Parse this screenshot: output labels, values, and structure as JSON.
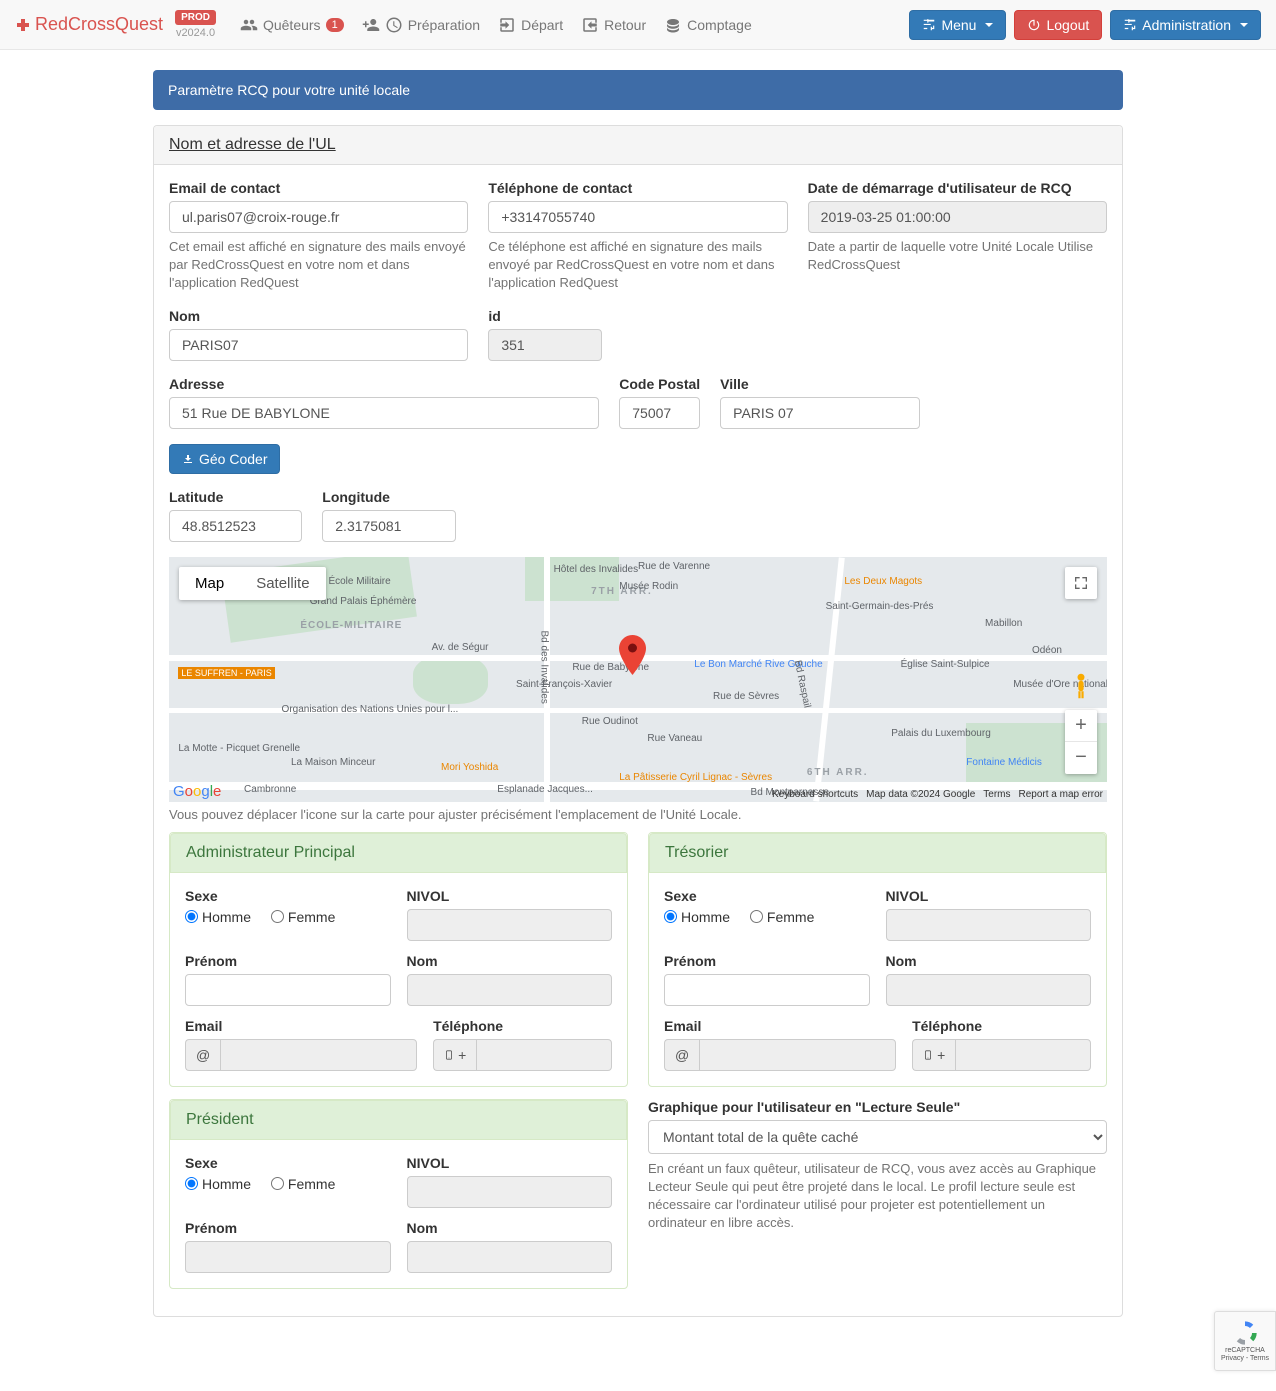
{
  "navbar": {
    "brand": "RedCrossQuest",
    "env_badge": "PROD",
    "version": "v2024.0",
    "items": {
      "queteurs": "Quêteurs",
      "queteurs_badge": "1",
      "preparation": "Préparation",
      "depart": "Départ",
      "retour": "Retour",
      "comptage": "Comptage"
    },
    "right": {
      "menu": "Menu",
      "logout": "Logout",
      "administration": "Administration"
    }
  },
  "page_header": "Paramètre RCQ pour votre unité locale",
  "section_title": "Nom et adresse de l'UL",
  "fields": {
    "email_label": "Email de contact",
    "email_value": "ul.paris07@croix-rouge.fr",
    "email_help": "Cet email est affiché en signature des mails envoyé par RedCrossQuest en votre nom et dans l'application RedQuest",
    "phone_label": "Téléphone de contact",
    "phone_value": "+33147055740",
    "phone_help": "Ce téléphone est affiché en signature des mails envoyé par RedCrossQuest en votre nom et dans l'application RedQuest",
    "date_label": "Date de démarrage d'utilisateur de RCQ",
    "date_value": "2019-03-25 01:00:00",
    "date_help": "Date a partir de laquelle votre Unité Locale Utilise RedCrossQuest",
    "nom_label": "Nom",
    "nom_value": "PARIS07",
    "id_label": "id",
    "id_value": "351",
    "adresse_label": "Adresse",
    "adresse_value": "51 Rue DE BABYLONE",
    "cp_label": "Code Postal",
    "cp_value": "75007",
    "ville_label": "Ville",
    "ville_value": "PARIS 07",
    "geo_coder": "Géo Coder",
    "lat_label": "Latitude",
    "lat_value": "48.8512523",
    "lon_label": "Longitude",
    "lon_value": "2.3175081"
  },
  "map": {
    "tab_map": "Map",
    "tab_satellite": "Satellite",
    "attribution": {
      "shortcuts": "Keyboard shortcuts",
      "data": "Map data ©2024 Google",
      "terms": "Terms",
      "report": "Report a map error"
    },
    "help": "Vous pouvez déplacer l'icone sur la carte pour ajuster précisément l'emplacement de l'Unité Locale.",
    "labels": {
      "ecole_militaire": "École Militaire",
      "ecole_militaire2": "ÉCOLE-MILITAIRE",
      "grand_palais": "Grand Palais Éphémère",
      "seventh_arr": "7TH ARR.",
      "le_suffren": "LE SUFFREN - PARIS",
      "org_nations": "Organisation des Nations Unies pour l...",
      "la_motte": "La Motte - Picquet Grenelle",
      "la_maison": "La Maison Minceur",
      "cambronne": "Cambronne",
      "mori": "Mori Yoshida",
      "esplanade": "Esplanade Jacques...",
      "rue_babylone": "Rue de Babylone",
      "saint_francois": "Saint-François-Xavier",
      "rue_oudinot": "Rue Oudinot",
      "rue_vaneau": "Rue Vaneau",
      "patisserie": "La Pâtisserie Cyril Lignac - Sèvres",
      "bon_marche": "Le Bon Marché Rive Gauche",
      "les_deux": "Les Deux Magots",
      "saint_germain": "Saint-Germain-des-Prés",
      "mabillon": "Mabillon",
      "saint_sulpice": "Église Saint-Sulpice",
      "odeon": "Odéon",
      "musee": "Musée d'Ore national du M",
      "lux": "Palais du Luxembourg",
      "fontaine": "Fontaine Médicis",
      "sixth_arr": "6TH ARR.",
      "hotel_invalides": "Hôtel des Invalides",
      "bd_invalides": "Bd des Invalides",
      "av_segur": "Av. de Ségur",
      "rue_varenne": "Rue de Varenne",
      "rue_sevres": "Rue de Sèvres",
      "bd_raspail": "Bd Raspail",
      "bd_montparnasse": "Bd Montparnasse",
      "musee_rodin": "Musée Rodin"
    }
  },
  "persons": {
    "admin_title": "Administrateur Principal",
    "tresorier_title": "Trésorier",
    "president_title": "Président",
    "sexe_label": "Sexe",
    "homme": "Homme",
    "femme": "Femme",
    "nivol_label": "NIVOL",
    "prenom_label": "Prénom",
    "nom_label": "Nom",
    "email_label": "Email",
    "telephone_label": "Téléphone",
    "at": "@",
    "plus": "+"
  },
  "readonly": {
    "label": "Graphique pour l'utilisateur en \"Lecture Seule\"",
    "option": "Montant total de la quête caché",
    "help": "En créant un faux quêteur, utilisateur de RCQ, vous avez accès au Graphique Lecteur Seule qui peut être projeté dans le local. Le profil lecture seule est nécessaire car l'ordinateur utilisé pour projeter est potentiellement un ordinateur en libre accès."
  },
  "recaptcha": {
    "l1": "reCAPTCHA",
    "l2": "Privacy - Terms"
  }
}
